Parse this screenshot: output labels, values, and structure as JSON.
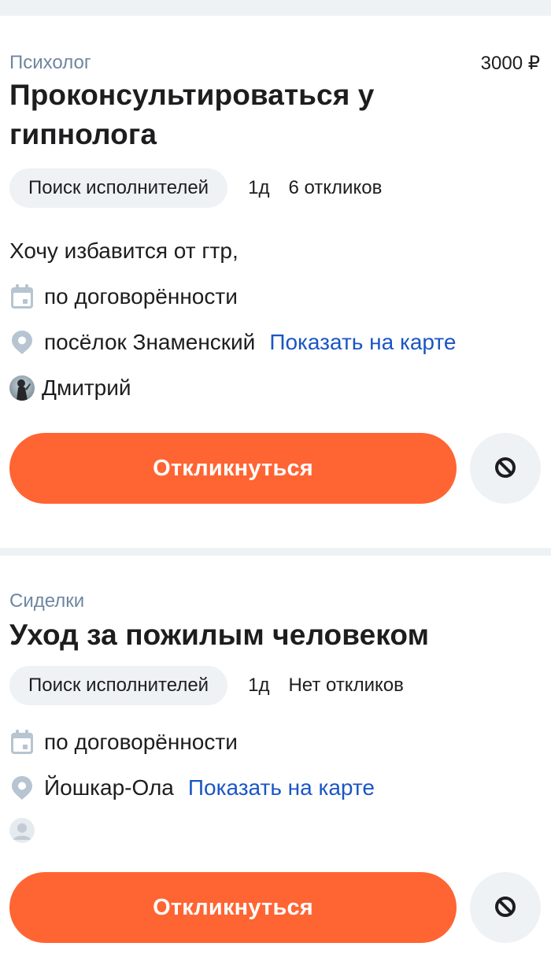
{
  "orders": [
    {
      "category": "Психолог",
      "price": "3000 ₽",
      "title_line1": "Проконсультироваться у",
      "title_line2": "гипнолога",
      "status": "Поиск исполнителей",
      "age": "1д",
      "responses": "6 откликов",
      "description": "Хочу избавится от гтр,",
      "date": "по договорённости",
      "location": "посёлок Знаменский",
      "map_link": "Показать на карте",
      "author": "Дмитрий",
      "respond_label": "Откликнуться"
    },
    {
      "category": "Сиделки",
      "title_line1": "Уход за пожилым человеком",
      "status": "Поиск исполнителей",
      "age": "1д",
      "responses": "Нет откликов",
      "date": "по договорённости",
      "location": "Йошкар-Ола",
      "map_link": "Показать на карте",
      "respond_label": "Откликнуться"
    }
  ],
  "icons": {
    "calendar": "calendar-icon",
    "location": "location-pin-icon",
    "hide": "block-icon",
    "avatar_placeholder": "user-placeholder-icon"
  },
  "colors": {
    "accent": "#ff6433",
    "link": "#1a56c4",
    "category": "#6f86a0",
    "chip_bg": "#eef2f5",
    "icon_gray": "#b7c4d1"
  }
}
